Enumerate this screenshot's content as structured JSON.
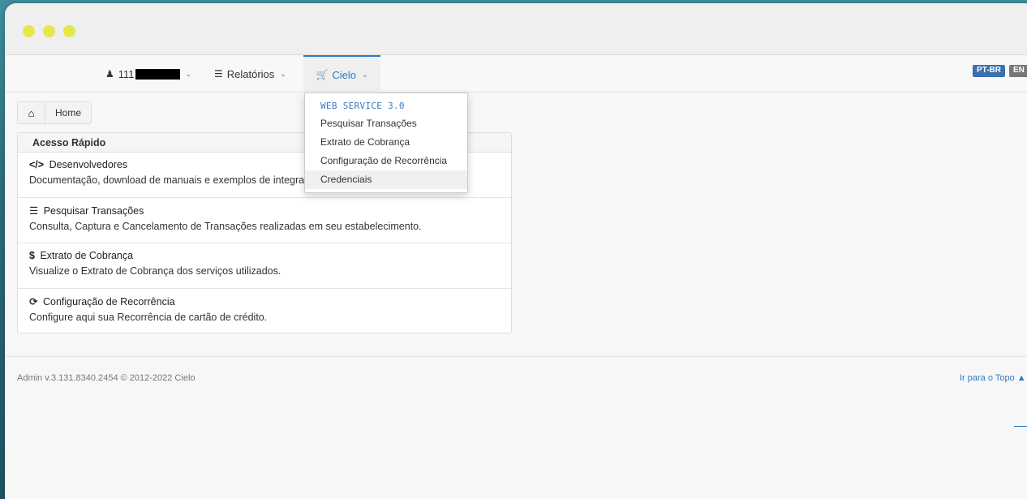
{
  "nav": {
    "user_label": "111",
    "relatorios_label": "Relatórios",
    "cielo_label": "Cielo",
    "lang_pt": "PT-BR",
    "lang_en": "EN"
  },
  "breadcrumb": {
    "home_label": "Home"
  },
  "panel": {
    "title": "Acesso Rápido",
    "items": [
      {
        "icon": "</>",
        "title": "Desenvolvedores",
        "desc": "Documentação, download de manuais e exemplos de integração."
      },
      {
        "icon": "☰",
        "title": "Pesquisar Transações",
        "desc": "Consulta, Captura e Cancelamento de Transações realizadas em seu estabelecimento."
      },
      {
        "icon": "$",
        "title": "Extrato de Cobrança",
        "desc": "Visualize o Extrato de Cobrança dos serviços utilizados."
      },
      {
        "icon": "⟳",
        "title": "Configuração de Recorrência",
        "desc": "Configure aqui sua Recorrência de cartão de crédito."
      }
    ]
  },
  "dropdown": {
    "header": "WEB SERVICE 3.0",
    "items": [
      "Pesquisar Transações",
      "Extrato de Cobrança",
      "Configuração de Recorrência",
      "Credenciais"
    ]
  },
  "footer": {
    "version": "Admin v.3.131.8340.2454 © 2012-2022 Cielo",
    "top_link": "Ir para o Topo"
  },
  "colors": {
    "accent": "#2e7bc4",
    "window_dots": "#e4e84a"
  }
}
